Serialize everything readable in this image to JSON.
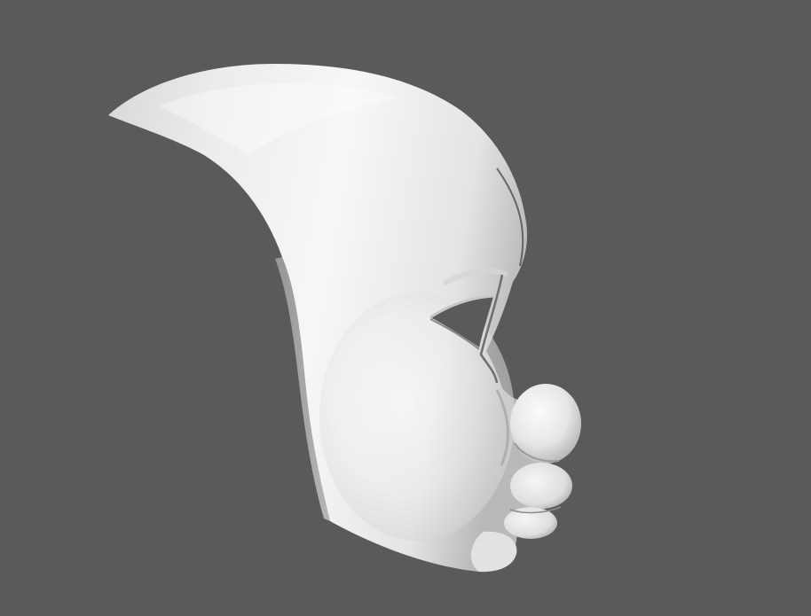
{
  "scene": {
    "background_color": "#5a5a5a",
    "model": "mask-icon",
    "surface_color": "#f2f2f2",
    "shadow_color": "#9c9c9c"
  }
}
